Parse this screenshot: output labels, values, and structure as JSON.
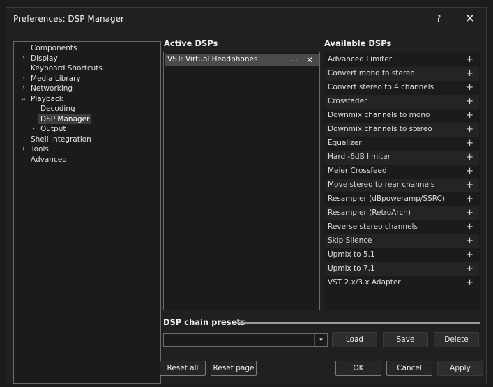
{
  "window": {
    "title": "Preferences: DSP Manager",
    "help_label": "?",
    "close_label": "✕"
  },
  "tree": {
    "items": [
      {
        "label": "Components",
        "indent": 0,
        "expander": ""
      },
      {
        "label": "Display",
        "indent": 0,
        "expander": "›"
      },
      {
        "label": "Keyboard Shortcuts",
        "indent": 0,
        "expander": ""
      },
      {
        "label": "Media Library",
        "indent": 0,
        "expander": "›"
      },
      {
        "label": "Networking",
        "indent": 0,
        "expander": "›"
      },
      {
        "label": "Playback",
        "indent": 0,
        "expander": "⌄"
      },
      {
        "label": "Decoding",
        "indent": 1,
        "expander": ""
      },
      {
        "label": "DSP Manager",
        "indent": 1,
        "expander": "",
        "selected": true
      },
      {
        "label": "Output",
        "indent": 1,
        "expander": "›"
      },
      {
        "label": "Shell Integration",
        "indent": 0,
        "expander": ""
      },
      {
        "label": "Tools",
        "indent": 0,
        "expander": "›"
      },
      {
        "label": "Advanced",
        "indent": 0,
        "expander": ""
      }
    ]
  },
  "active": {
    "heading": "Active DSPs",
    "items": [
      {
        "label": "VST: Virtual Headphones",
        "more": "...",
        "remove": "✕"
      }
    ]
  },
  "available": {
    "heading": "Available DSPs",
    "add_symbol": "+",
    "items": [
      "Advanced Limiter",
      "Convert mono to stereo",
      "Convert stereo to 4 channels",
      "Crossfader",
      "Downmix channels to mono",
      "Downmix channels to stereo",
      "Equalizer",
      "Hard -6dB limiter",
      "Meier Crossfeed",
      "Move stereo to rear channels",
      "Resampler (dBpoweramp/SSRC)",
      "Resampler (RetroArch)",
      "Reverse stereo channels",
      "Skip Silence",
      "Upmix to 5.1",
      "Upmix to 7.1",
      "VST 2.x/3.x Adapter"
    ]
  },
  "presets": {
    "heading": "DSP chain presets",
    "selected": "",
    "load": "Load",
    "save": "Save",
    "delete": "Delete"
  },
  "footer": {
    "reset_all": "Reset all",
    "reset_page": "Reset page",
    "ok": "OK",
    "cancel": "Cancel",
    "apply": "Apply"
  }
}
